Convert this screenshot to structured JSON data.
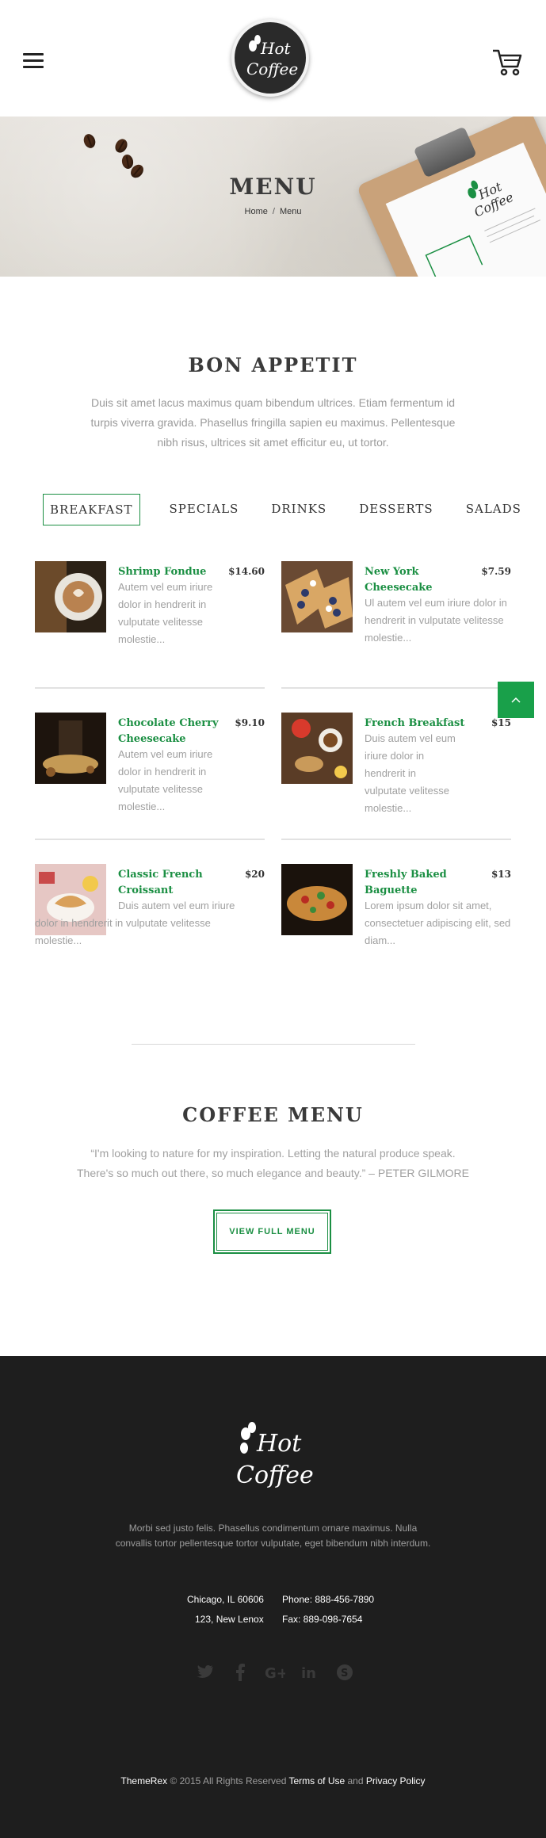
{
  "header": {
    "logo_text_1": "Hot",
    "logo_text_2": "Coffee",
    "menu_icon": "hamburger-icon",
    "cart_icon": "cart-icon"
  },
  "banner": {
    "title": "MENU",
    "breadcrumb_home": "Home",
    "breadcrumb_sep": "/",
    "breadcrumb_current": "Menu",
    "clipboard_logo_1": "Hot",
    "clipboard_logo_2": "Coffee"
  },
  "bon_appetit": {
    "title": "BON APPETIT",
    "text": "Duis sit amet lacus maximus quam bibendum ultrices. Etiam fermentum id turpis viverra gravida. Phasellus fringilla sapien eu maximus. Pellentesque nibh risus, ultrices sit amet efficitur eu, ut tortor."
  },
  "tabs": [
    {
      "label": "BREAKFAST",
      "active": true
    },
    {
      "label": "SPECIALS",
      "active": false
    },
    {
      "label": "DRINKS",
      "active": false
    },
    {
      "label": "DESSERTS",
      "active": false
    },
    {
      "label": "SALADS",
      "active": false
    }
  ],
  "menu_items": [
    {
      "name": "Shrimp Fondue",
      "price": "$14.60",
      "desc": "Autem vel eum iriure dolor in hendrerit in vulputate velitesse molestie..."
    },
    {
      "name": "New York Cheesecake",
      "price": "$7.59",
      "desc": "Ul autem vel eum iriure dolor in hendrerit in vulputate velitesse molestie..."
    },
    {
      "name": "Chocolate Cherry Cheesecake",
      "price": "$9.10",
      "desc": "Autem vel eum iriure dolor in hendrerit in vulputate velitesse molestie..."
    },
    {
      "name": "French Breakfast",
      "price": "$15",
      "desc": "Duis autem vel eum iriure dolor in hendrerit in vulputate velitesse molestie..."
    },
    {
      "name": "Classic French Croissant",
      "price": "$20",
      "desc": "Duis autem vel eum iriure dolor in hendrerit in vulputate velitesse molestie..."
    },
    {
      "name": "Freshly Baked Baguette",
      "price": "$13",
      "desc": "Lorem ipsum dolor sit amet, consectetuer adipiscing elit, sed diam..."
    }
  ],
  "coffee_menu": {
    "title": "COFFEE MENU",
    "quote": "“I'm looking to nature for my inspiration. Letting the natural produce speak. There's so much out there, so much elegance and beauty.” – PETER GILMORE",
    "button_label": "VIEW FULL MENU"
  },
  "footer": {
    "logo_text_1": "Hot",
    "logo_text_2": "Coffee",
    "blurb": "Morbi sed justo felis. Phasellus condimentum ornare maximus. Nulla convallis tortor pellentesque tortor vulputate, eget bibendum nibh interdum.",
    "address_line_1": "Chicago, IL 60606",
    "address_line_2": "123, New Lenox",
    "phone": "Phone: 888-456-7890",
    "fax": "Fax: 889-098-7654",
    "social": [
      "twitter-icon",
      "facebook-icon",
      "google-plus-icon",
      "linkedin-icon",
      "skype-icon"
    ],
    "copyright_brand": "ThemeRex",
    "copyright_text": " © 2015 All Rights Reserved ",
    "terms_label": "Terms of Use",
    "and_text": " and ",
    "privacy_label": "Privacy Policy"
  },
  "colors": {
    "accent_green": "#1b8f43",
    "scroll_top_green": "#19a04a",
    "footer_bg": "#1e1e1e"
  }
}
